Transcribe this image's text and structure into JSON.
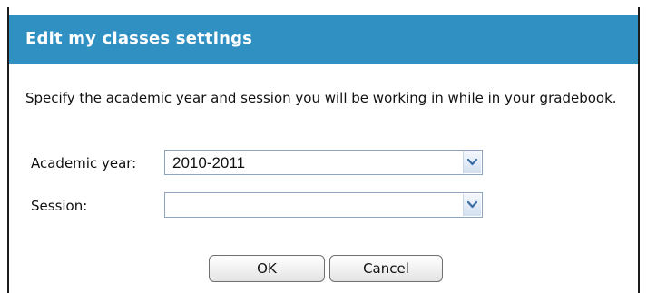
{
  "dialog": {
    "title": "Edit my classes settings",
    "instructions": "Specify the academic year and session you will be working in while in your gradebook."
  },
  "form": {
    "academic_year": {
      "label": "Academic year:",
      "value": "2010-2011"
    },
    "session": {
      "label": "Session:",
      "value": ""
    }
  },
  "buttons": {
    "ok_label": "OK",
    "cancel_label": "Cancel"
  },
  "icons": {
    "dropdown": "chevron-down-icon"
  },
  "colors": {
    "titlebar": "#3090c2",
    "title_text": "#ffffff",
    "dropdown_arrow": "#3a6ea5"
  }
}
